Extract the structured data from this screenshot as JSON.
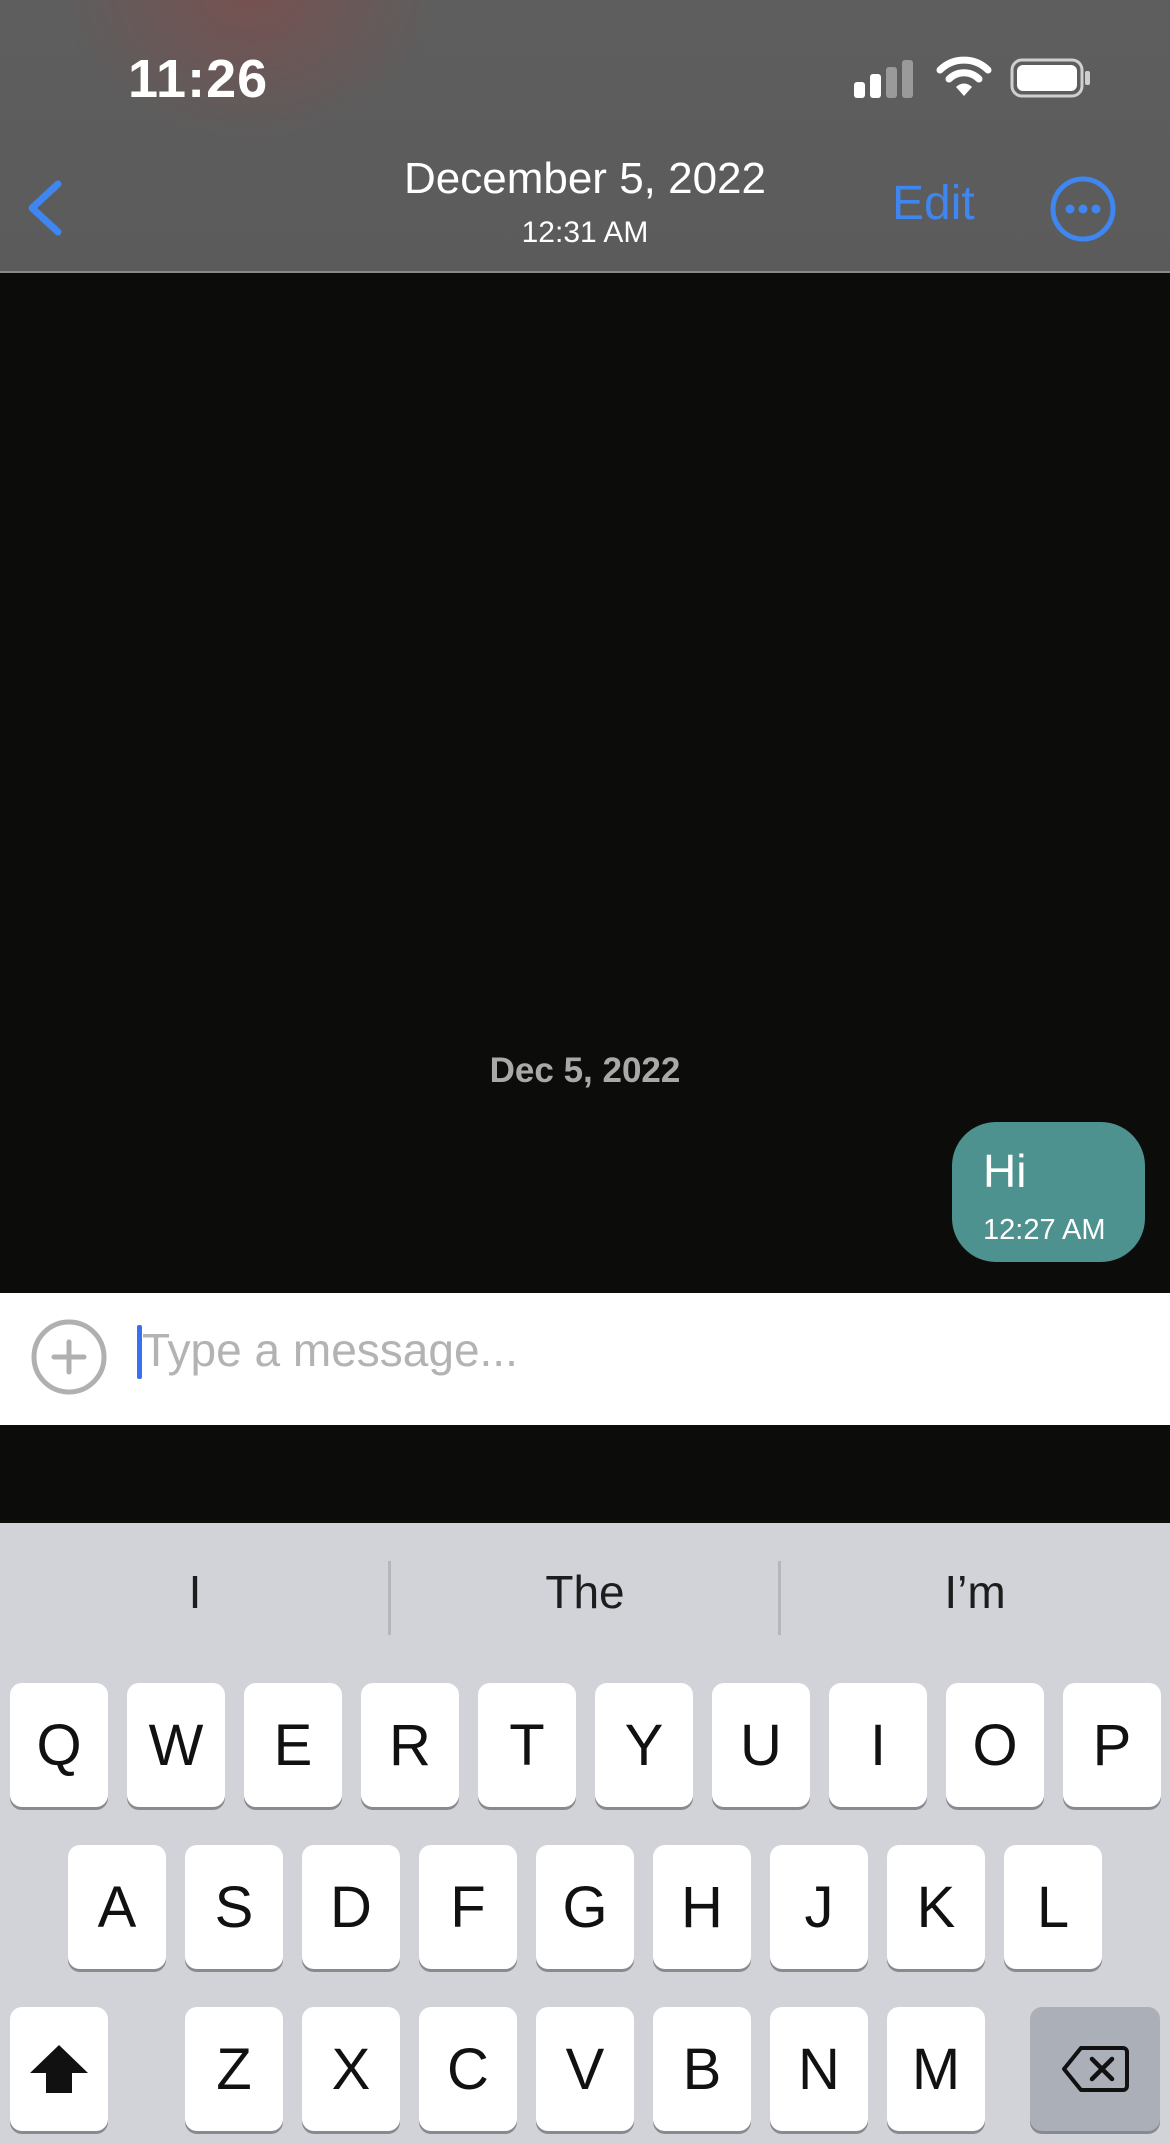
{
  "status_bar": {
    "time": "11:26",
    "signal_icon": "cellular-signal-icon",
    "wifi_icon": "wifi-icon",
    "battery_icon": "battery-icon"
  },
  "nav": {
    "back_icon": "chevron-left-icon",
    "title": "December 5, 2022",
    "subtitle": "12:31 AM",
    "edit_label": "Edit",
    "more_icon": "ellipsis-circle-icon"
  },
  "conversation": {
    "date_separator": "Dec 5, 2022",
    "messages": [
      {
        "text": "Hi",
        "time": "12:27 AM",
        "outgoing": true
      }
    ]
  },
  "composer": {
    "attach_icon": "plus-circle-icon",
    "placeholder": "Type a message...",
    "value": ""
  },
  "keyboard": {
    "suggestions": [
      "I",
      "The",
      "I’m"
    ],
    "row1": [
      "Q",
      "W",
      "E",
      "R",
      "T",
      "Y",
      "U",
      "I",
      "O",
      "P"
    ],
    "row2": [
      "A",
      "S",
      "D",
      "F",
      "G",
      "H",
      "J",
      "K",
      "L"
    ],
    "row3": [
      "Z",
      "X",
      "C",
      "V",
      "B",
      "N",
      "M"
    ],
    "shift_icon": "shift-arrow-icon",
    "delete_icon": "backspace-icon"
  },
  "colors": {
    "accent": "#3f86f0",
    "bubble": "#4e9290",
    "chat_background": "#0c0d0b",
    "keyboard_background": "#d1d3d9"
  }
}
